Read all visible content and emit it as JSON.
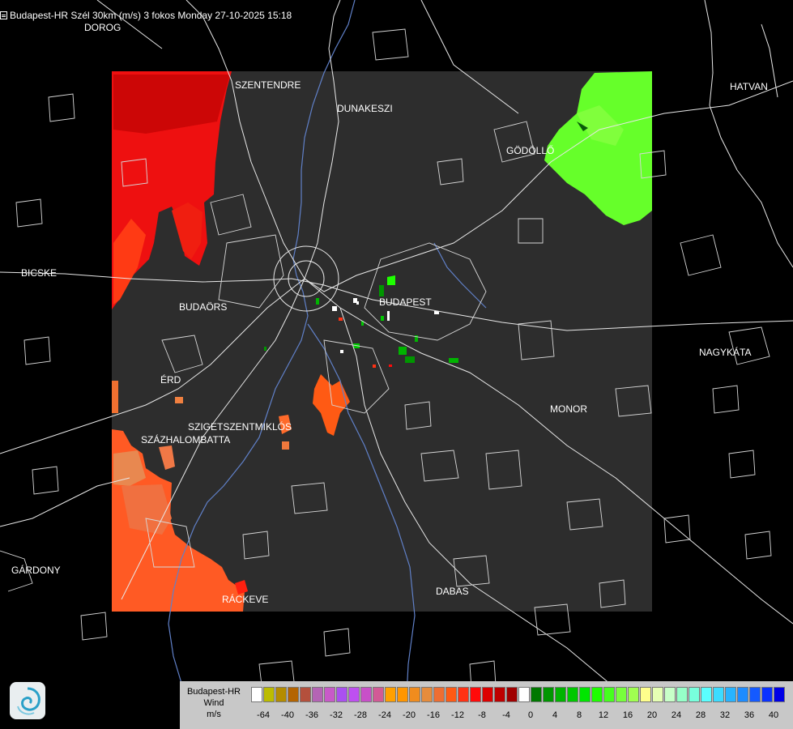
{
  "header": {
    "title": "Budapest-HR Szél 30km (m/s) 3 fokos Monday 27-10-2025 15:18"
  },
  "cities": [
    {
      "name": "DOROG"
    },
    {
      "name": "SZENTENDRE"
    },
    {
      "name": "DUNAKESZI"
    },
    {
      "name": "HATVAN"
    },
    {
      "name": "GÖDÖLLŐ"
    },
    {
      "name": "BICSKE"
    },
    {
      "name": "BUDAÖRS"
    },
    {
      "name": "BUDAPEST"
    },
    {
      "name": "NAGYKÁTA"
    },
    {
      "name": "ÉRD"
    },
    {
      "name": "MONOR"
    },
    {
      "name": "SZIGETSZENTMIKLÓS"
    },
    {
      "name": "SZÁZHALOMBATTA"
    },
    {
      "name": "GÁRDONY"
    },
    {
      "name": "RÁCKEVE"
    },
    {
      "name": "DABAS"
    }
  ],
  "legend": {
    "line1": "Budapest-HR",
    "line2": "Wind",
    "unit": "m/s",
    "colors": [
      "#ffffff",
      "#bcbc00",
      "#b48c00",
      "#b46400",
      "#b4503c",
      "#b464b4",
      "#c85ac8",
      "#aa50f0",
      "#be50f0",
      "#c850c8",
      "#d25a96",
      "#ffa000",
      "#ff9600",
      "#f08c1e",
      "#e68c3c",
      "#ee6e32",
      "#ff5a14",
      "#ff3214",
      "#ff0a0a",
      "#dc0000",
      "#be0000",
      "#a00000",
      "#ffffff",
      "#007800",
      "#009600",
      "#00b400",
      "#00c800",
      "#00e600",
      "#1eff00",
      "#46ff1e",
      "#78ff3c",
      "#a0ff50",
      "#ffff8c",
      "#e6ffb4",
      "#c8ffc8",
      "#96ffc8",
      "#78ffdc",
      "#5affff",
      "#3cdcff",
      "#28b4ff",
      "#1e8cff",
      "#145aff",
      "#0a32ff",
      "#0000e6"
    ],
    "ticks": [
      "-64",
      "-40",
      "-36",
      "-32",
      "-28",
      "-24",
      "-20",
      "-16",
      "-12",
      "-8",
      "-4",
      "0",
      "4",
      "8",
      "12",
      "16",
      "20",
      "24",
      "28",
      "32",
      "36",
      "40"
    ]
  }
}
